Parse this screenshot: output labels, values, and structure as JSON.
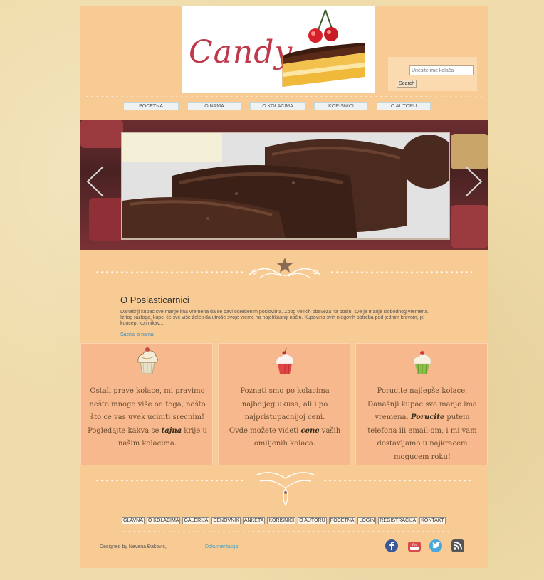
{
  "header": {
    "logo_text": "Candy",
    "search_placeholder": "Unesite ime kolača",
    "search_button": "Search"
  },
  "nav": [
    {
      "label": "POCETNA"
    },
    {
      "label": "O NAMA"
    },
    {
      "label": "O KOLACIMA"
    },
    {
      "label": "KORISNICI"
    },
    {
      "label": "O AUTORU"
    }
  ],
  "about": {
    "title": "O Poslasticarnici",
    "text": "Današnji kupac sve manje ima vremena da se bavi određenim poslovima. Zbog velikih obaveza na poslu, sve je manje slobodnog vremena. Iz tog razloga, kupci će sve više želeti da utroše svoje vreme na najefikasniji način. Kupovina svih njegovih potreba pod jednim krovom, je koncept koji nikav....",
    "link": "Saznaj o nama"
  },
  "boxes": [
    {
      "icon": "cupcake-icon",
      "text_html": "Ostali prave kolace, mi pravimo nešto mnogo više od toga, nešto što ce vas uvek uciniti srecnim!<br>Pogledajte kakva se <b>tajna</b> krije u našim kolacima."
    },
    {
      "icon": "red-cupcake-icon",
      "text_html": "Poznati smo po kolacima najboljeg ukusa, ali i po najpristupacnijoj ceni.<br>Ovde možete videti <b>cene</b> vaših omiljenih kolaca."
    },
    {
      "icon": "green-cupcake-icon",
      "text_html": "Porucite najlepše kolace.<br>Današnji kupac sve manje ima vremena. <b>Porucite</b> putem telefona ili email-om, i mi vam dostavljamo u najkracem mogucem roku!"
    }
  ],
  "footer": {
    "links": [
      "GLAVNA",
      "O KOLACIMA",
      "GALERIJA",
      "CENOVNIK",
      "ANKETA",
      "KORISNICI",
      "O AUTORU",
      "POCETNA",
      "LOGIN",
      "REGISTRACIJA",
      "KONTAKT"
    ],
    "credit": "Designed by Nevena Đaković,",
    "credit_link": "Dokumentacija",
    "social": [
      "facebook-icon",
      "youtube-icon",
      "twitter-icon",
      "rss-icon"
    ]
  },
  "colors": {
    "page": "#f8cb94",
    "box": "#f6b88c",
    "logo_red": "#c0394a"
  }
}
